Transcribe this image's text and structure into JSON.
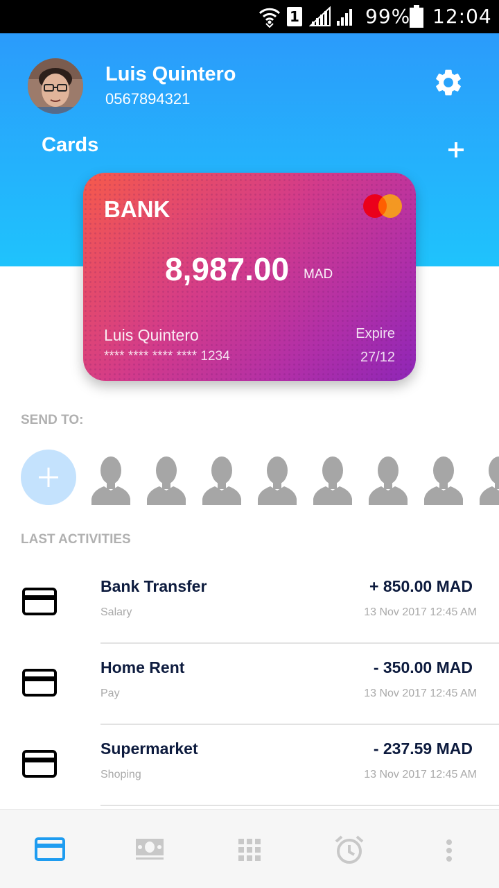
{
  "status_bar": {
    "sim": "1",
    "battery": "99%",
    "time": "12:04"
  },
  "profile": {
    "name": "Luis Quintero",
    "phone": "0567894321"
  },
  "cards_section": {
    "title": "Cards"
  },
  "card": {
    "bank": "BANK",
    "balance": "8,987.00",
    "currency": "MAD",
    "holder": "Luis Quintero",
    "number": "**** **** **** **** 1234",
    "expire_label": "Expire",
    "expire_date": "27/12",
    "colors": {
      "start": "#f65a4b",
      "end": "#8e26b7"
    }
  },
  "send_to": {
    "title": "SEND TO:",
    "contacts_count": 8
  },
  "activities": {
    "title": "LAST ACTIVITIES",
    "items": [
      {
        "title": "Bank Transfer",
        "subtitle": "Salary",
        "amount": "+ 850.00 MAD",
        "date": "13 Nov 2017 12:45 AM"
      },
      {
        "title": "Home Rent",
        "subtitle": "Pay",
        "amount": "- 350.00 MAD",
        "date": "13 Nov 2017 12:45 AM"
      },
      {
        "title": "Supermarket",
        "subtitle": "Shoping",
        "amount": "- 237.59 MAD",
        "date": "13 Nov 2017 12:45 AM"
      }
    ]
  },
  "bottom_nav": {
    "items": [
      "card-icon",
      "money-icon",
      "grid-icon",
      "alarm-icon",
      "more-icon"
    ],
    "active_color": "#1e9cf0",
    "inactive_color": "#c8c8c8"
  },
  "theme": {
    "header_top": "#2b9bfb",
    "header_bottom": "#1fc3fc",
    "text_dark": "#0d1b3e"
  }
}
